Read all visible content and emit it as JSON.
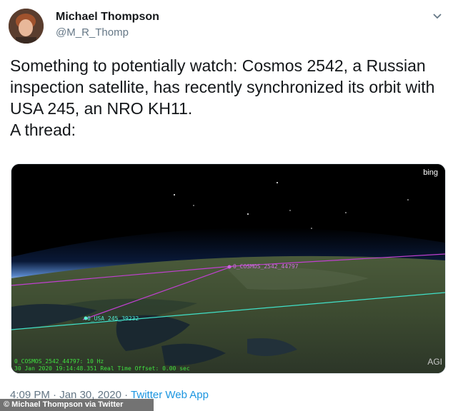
{
  "author": {
    "name": "Michael Thompson",
    "handle": "@M_R_Thomp"
  },
  "tweet": {
    "text": "Something to potentially watch: Cosmos 2542, a Russian inspection satellite, has recently synchronized its orbit with USA 245, an NRO KH11.\nA thread:"
  },
  "media": {
    "watermark": "bing",
    "logo": "AGI",
    "labels": {
      "cosmos": "0_COSMOS_2542_44797",
      "usa": "0_USA_245_39232",
      "status_line1": "0_COSMOS_2542_44797: 10 Hz",
      "status_line2": "30 Jan 2020 19:14:48.351     Real Time Offset: 0.00 sec"
    },
    "colors": {
      "cosmos_orbit": "#c040d0",
      "usa_orbit": "#40e0c8",
      "status_text": "#40e040"
    }
  },
  "meta": {
    "time": "4:09 PM",
    "separator": " · ",
    "date": "Jan 30, 2020",
    "app": "Twitter Web App"
  },
  "credit": "© Michael Thompson via Twitter"
}
